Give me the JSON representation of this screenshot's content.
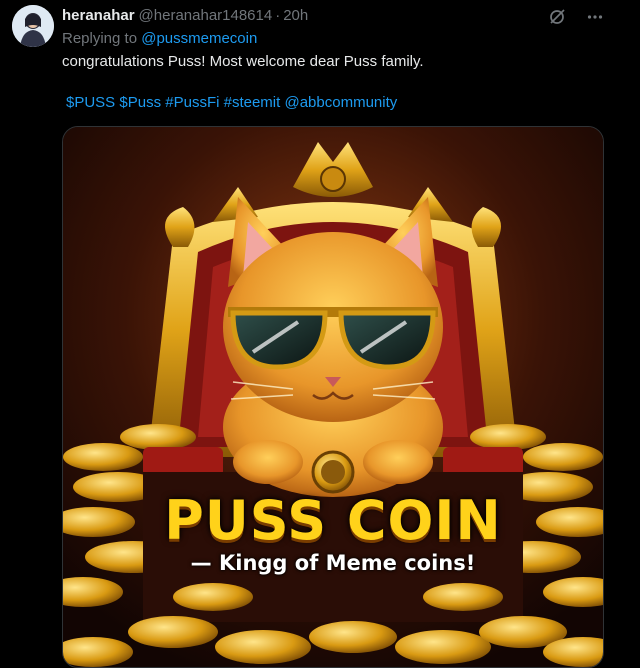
{
  "tweet": {
    "display_name": "heranahar",
    "handle": "@heranahar148614",
    "separator": "·",
    "time": "20h",
    "replying_prefix": "Replying to ",
    "replying_to": "@pussmemecoin",
    "text": "congratulations Puss! Most welcome dear Puss family.",
    "hashtags": [
      "$PUSS",
      "$Puss",
      "#PussFi",
      "#steemit",
      "@abbcommunity"
    ],
    "icons": {
      "grok": "grok-icon",
      "more": "more-icon"
    }
  },
  "media": {
    "title": "PUSS COIN",
    "subtitle": "— Kingg of Meme coins!"
  },
  "colors": {
    "accent": "#1d9bf0",
    "muted": "#71767b",
    "text": "#e7e9ea",
    "background": "#000000"
  }
}
